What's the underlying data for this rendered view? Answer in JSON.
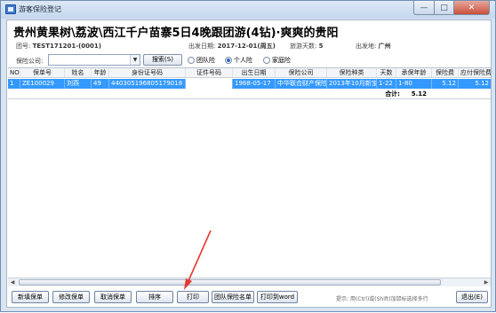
{
  "window": {
    "title": "游客保险登记",
    "min_label": "—",
    "max_label": "□",
    "close_label": "✕"
  },
  "tour": {
    "title": "贵州黄果树\\荔波\\西江千户苗寨5日4晚跟团游(4钻)·爽爽的贵阳",
    "group_label": "团号:",
    "group_value": "TEST171201-(0001)",
    "depart_label": "出发日期:",
    "depart_value": "2017-12-01(周五)",
    "days_label": "旅游天数:",
    "days_value": "5",
    "origin_label": "出发地:",
    "origin_value": "广州"
  },
  "filter": {
    "company_label": "保险公司:",
    "company_value": "",
    "search_label": "搜索(S)",
    "options": [
      {
        "label": "团队险",
        "selected": false
      },
      {
        "label": "个人险",
        "selected": true
      },
      {
        "label": "家庭险",
        "selected": false
      }
    ]
  },
  "grid": {
    "columns": [
      "NO",
      "保单号",
      "姓名",
      "年龄",
      "身份证号码",
      "证件号码",
      "出生日期",
      "保险公司",
      "保险种类",
      "天数",
      "承保年龄",
      "保险费",
      "应付保险费"
    ],
    "rows": [
      [
        "1",
        "ZE100029",
        "刘燕",
        "49",
        "440305196805179018",
        "",
        "1968-05-17",
        "中华联合财产保险",
        "2013年10月新宝",
        "1-22",
        "1-80",
        "5.12",
        "5.12"
      ]
    ],
    "total_label": "合计:",
    "total_value": "5.12"
  },
  "toolbar": {
    "buttons": [
      "新填保单",
      "修改保单",
      "取消保单",
      "排序",
      "打印",
      "团队保险名单",
      "打印到word"
    ],
    "hint": "提示: 用(Ctrl)或(Shift)加鼠标选择多行",
    "exit_label": "退出(E)"
  },
  "colors": {
    "selection": "#3399ff",
    "annotation_arrow": "#e53935"
  }
}
